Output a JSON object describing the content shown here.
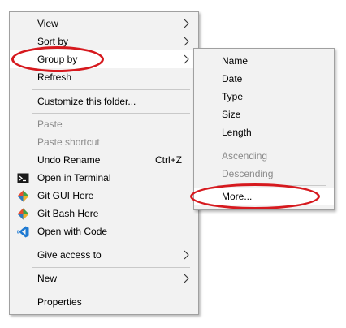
{
  "main_menu": {
    "view": "View",
    "sort_by": "Sort by",
    "group_by": "Group by",
    "refresh": "Refresh",
    "customize": "Customize this folder...",
    "paste": "Paste",
    "paste_shortcut": "Paste shortcut",
    "undo_rename": "Undo Rename",
    "undo_rename_shortcut": "Ctrl+Z",
    "open_terminal": "Open in Terminal",
    "git_gui": "Git GUI Here",
    "git_bash": "Git Bash Here",
    "open_code": "Open with Code",
    "give_access": "Give access to",
    "new": "New",
    "properties": "Properties"
  },
  "group_by_submenu": {
    "name": "Name",
    "date": "Date",
    "type": "Type",
    "size": "Size",
    "length": "Length",
    "ascending": "Ascending",
    "descending": "Descending",
    "more": "More..."
  },
  "icons": {
    "terminal": "terminal-icon",
    "git_gui": "git-diamond-icon",
    "git_bash": "git-diamond-icon",
    "vscode": "vscode-icon",
    "submenu_arrow": "chevron-right-icon"
  },
  "colors": {
    "menu_background": "#f2f2f2",
    "disabled_text": "#8a8a8a",
    "annotation_red": "#d6191e"
  }
}
